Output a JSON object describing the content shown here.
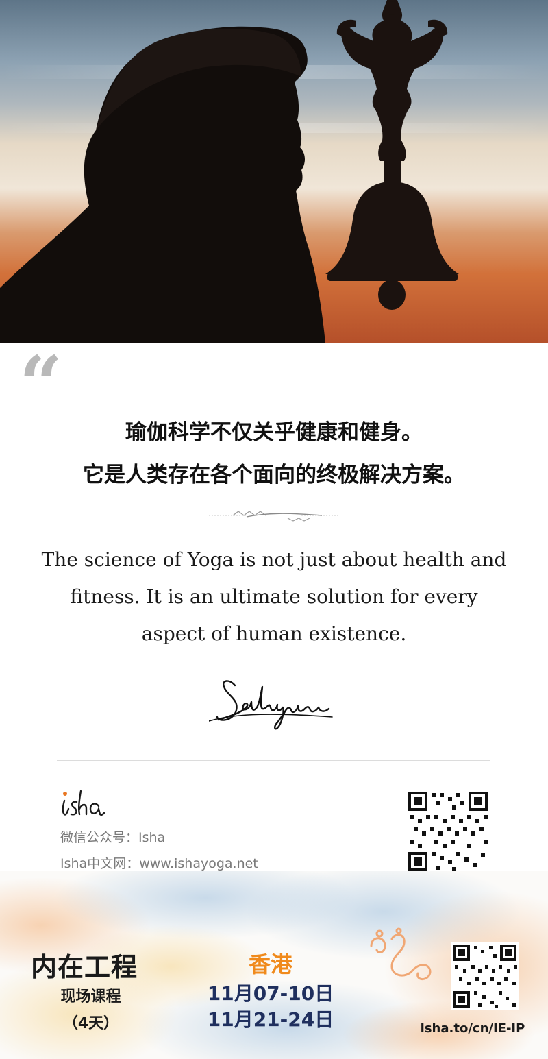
{
  "quote": {
    "mark": "“",
    "chinese_lines": [
      "瑜伽科学不仅关乎健康和健身。",
      "它是人类存在各个面向的终极解决方案。"
    ],
    "english": "The science of Yoga is not just about health and fitness. It is an ultimate solution for every aspect of human existence.",
    "signature": "Sadhguru"
  },
  "footer": {
    "logo": "isha",
    "wechat": "微信公众号：Isha",
    "website": "Isha中文网：www.ishayoga.net"
  },
  "banner": {
    "program_title": "内在工程",
    "program_subtitle": "现场课程",
    "program_days": "（4天）",
    "city": "香港",
    "dates": [
      "11月07-10日",
      "11月21-24日"
    ],
    "short_url": "isha.to/cn/IE-IP"
  },
  "colors": {
    "accent_orange": "#f08a1c",
    "date_navy": "#1f2f5e",
    "muted_gray": "#7a7a7a"
  },
  "icons": {
    "quote": "open-quote-icon",
    "ornament": "divider-ornament-icon",
    "qr": "qr-code-icon",
    "flourish": "flourish-icon"
  }
}
